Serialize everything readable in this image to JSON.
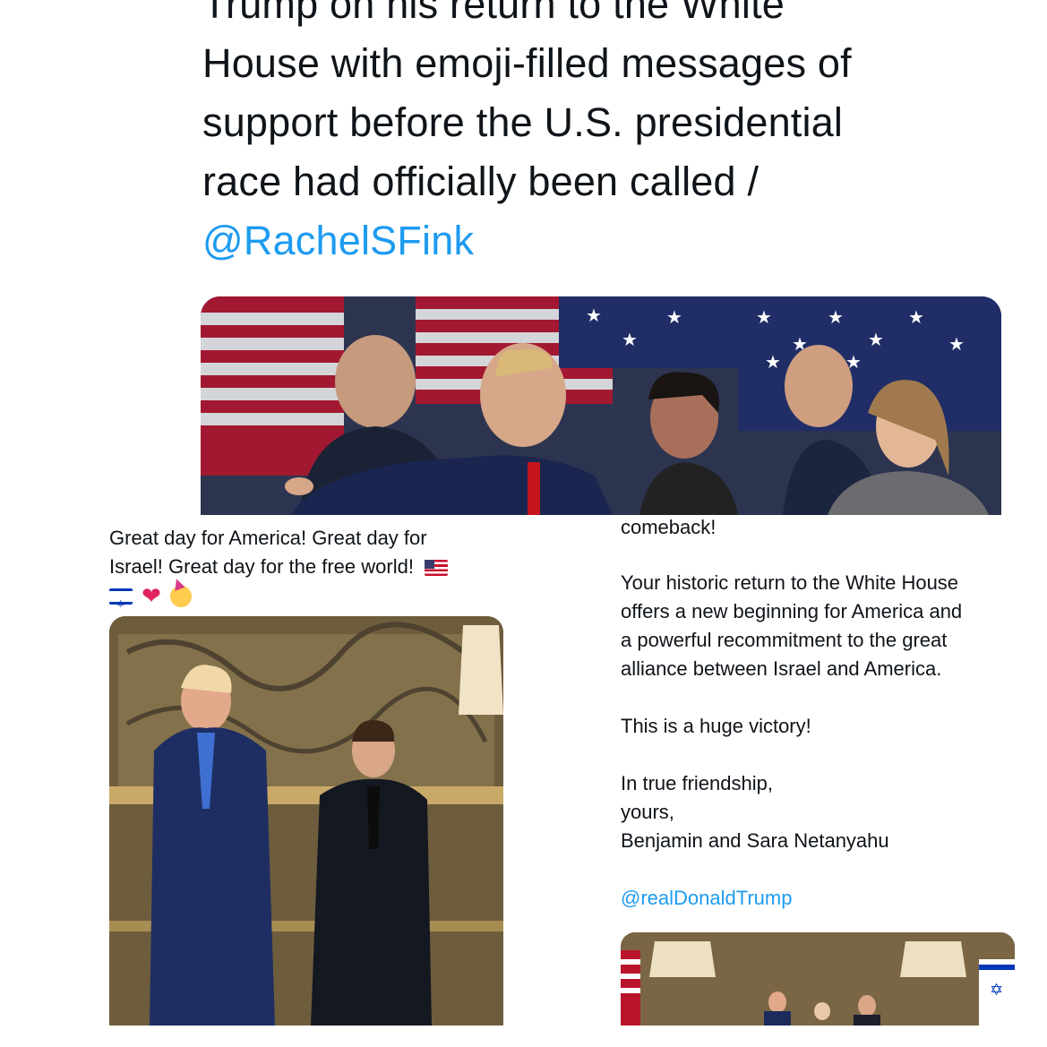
{
  "top_tweet": {
    "lines": [
      "Trump on his return to the White",
      "House with emoji-filled messages of",
      "support before the U.S. presidential",
      "race had officially been called /"
    ],
    "mention": "@RachelSFink",
    "photo_alt": "Photo of Trump pointing at election night event with flags behind"
  },
  "bottom_left_tweet": {
    "lines": [
      "Great day for America! Great day for",
      "Israel! Great day for the free world!"
    ],
    "emojis": [
      "flag-us",
      "flag-il",
      "red-heart",
      "partying-face"
    ],
    "photo_alt": "Trump and a man in a suit giving thumbs up in an ornate room"
  },
  "bottom_right_tweet": {
    "line_top": "comeback!",
    "para1": [
      "Your historic return to the White House",
      "offers a new beginning for America and",
      "a powerful recommitment to the great",
      "alliance between Israel and America."
    ],
    "para2": "This is a huge victory!",
    "sign": [
      "In true friendship,",
      "yours,",
      "Benjamin and Sara Netanyahu"
    ],
    "mention": "@realDonaldTrump",
    "photo_alt": "Trump with Netanyahu couple in ornate room with lamps"
  }
}
